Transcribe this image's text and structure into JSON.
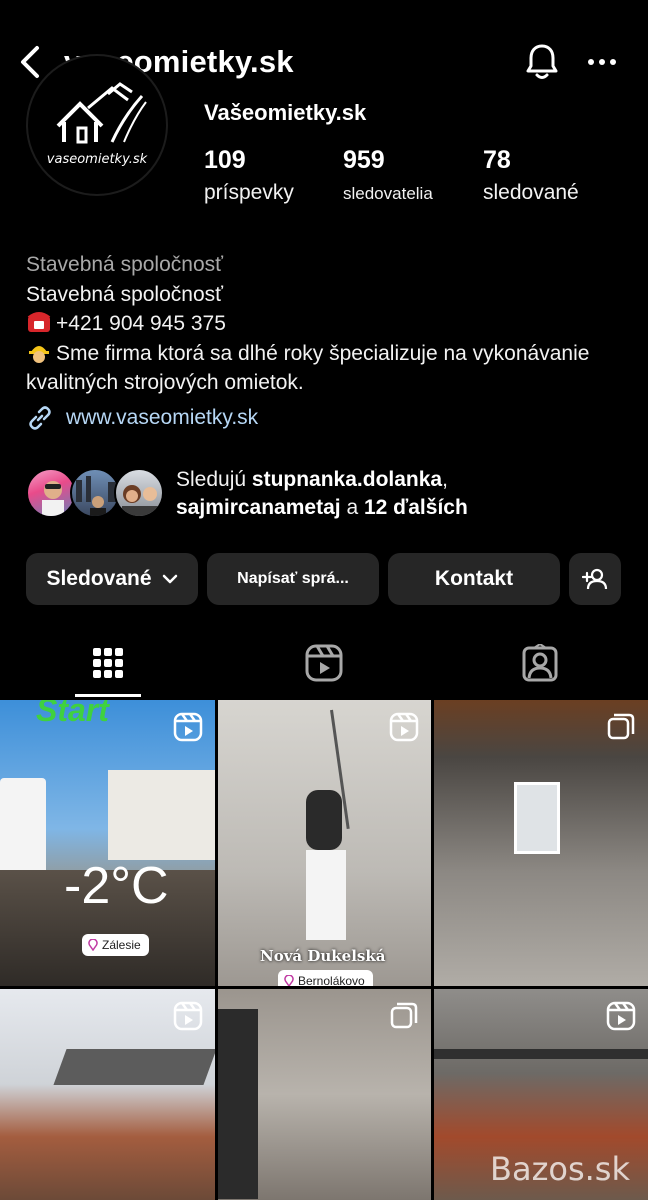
{
  "header": {
    "username": "vaseomietky.sk",
    "icons": [
      "chevron-left-icon",
      "bell-icon",
      "more-icon"
    ]
  },
  "profile": {
    "avatar_text": "vaseomietky.sk",
    "display_name": "Vašeomietky.sk",
    "stats": [
      {
        "num": "109",
        "label": "príspevky"
      },
      {
        "num": "959",
        "label": "sledovatelia"
      },
      {
        "num": "78",
        "label": "sledované"
      }
    ]
  },
  "bio": {
    "category": "Stavebná spoločnosť",
    "line1": "Stavebná spoločnosť",
    "phone": "+421 904 945 375",
    "desc": "Sme firma ktorá sa dlhé roky špecializuje na vykonávanie kvalitných strojových omietok.",
    "link": "www.vaseomietky.sk"
  },
  "followed_by": {
    "prefix": "Sledujú ",
    "user1": "stupnanka.dolanka",
    "comma": ",",
    "user2": "sajmircanametaj",
    "middle": " a ",
    "others": "12 ďalších"
  },
  "buttons": {
    "following": "Sledované",
    "message": "Napísať sprá...",
    "contact": "Kontakt"
  },
  "tabs": [
    "grid-icon",
    "reels-icon",
    "tagged-icon"
  ],
  "posts": [
    {
      "overlay": "-2°C",
      "top_text": "Start",
      "location": "Zálesie",
      "type": "reel"
    },
    {
      "overlay": "Nová Dukelská",
      "location": "Bernolákovo",
      "type": "reel"
    },
    {
      "type": "carousel"
    },
    {
      "type": "reel"
    },
    {
      "type": "carousel"
    },
    {
      "type": "reel",
      "watermark": "Bazos.sk"
    }
  ]
}
